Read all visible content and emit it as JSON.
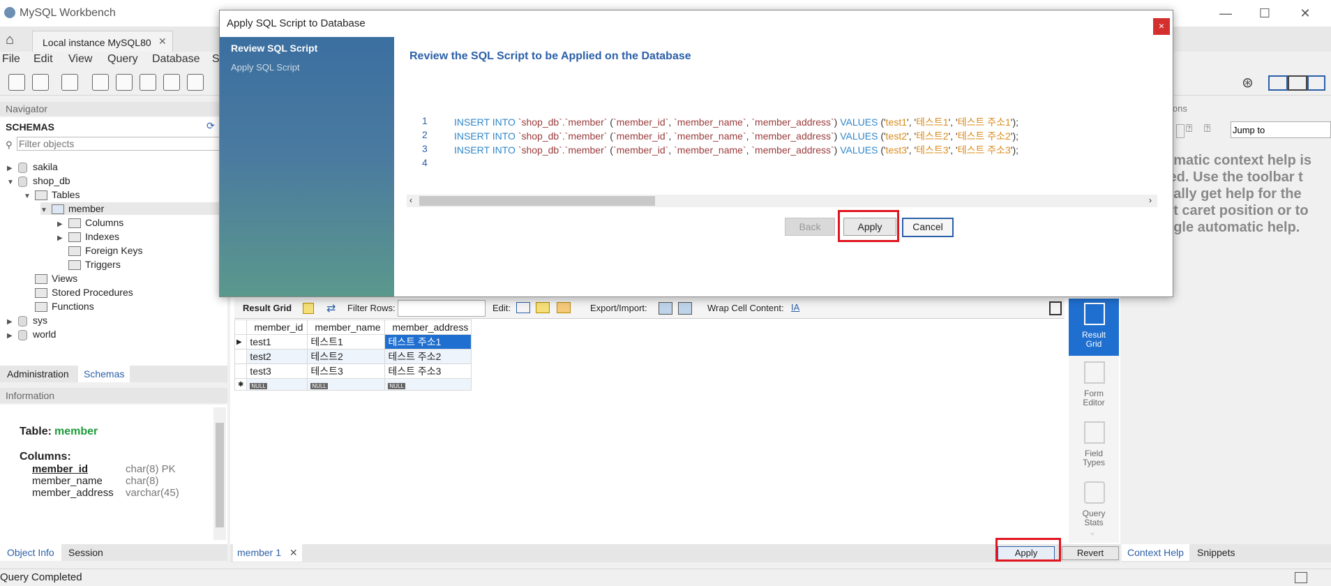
{
  "window": {
    "app_title": "MySQL Workbench",
    "connection_tab": "Local instance MySQL80"
  },
  "menu": [
    "File",
    "Edit",
    "View",
    "Query",
    "Database",
    "S"
  ],
  "navigator": {
    "header": "Navigator",
    "schemas_label": "SCHEMAS",
    "filter_placeholder": "Filter objects",
    "tree": [
      {
        "label": "sakila",
        "level": 0,
        "type": "db",
        "expander": "▶"
      },
      {
        "label": "shop_db",
        "level": 0,
        "type": "db",
        "expander": "▼"
      },
      {
        "label": "Tables",
        "level": 1,
        "type": "folder",
        "expander": "▼"
      },
      {
        "label": "member",
        "level": 2,
        "type": "table",
        "expander": "▼"
      },
      {
        "label": "Columns",
        "level": 3,
        "type": "folder",
        "expander": "▶"
      },
      {
        "label": "Indexes",
        "level": 3,
        "type": "folder",
        "expander": "▶"
      },
      {
        "label": "Foreign Keys",
        "level": 3,
        "type": "folder",
        "expander": ""
      },
      {
        "label": "Triggers",
        "level": 3,
        "type": "folder",
        "expander": ""
      },
      {
        "label": "Views",
        "level": 1,
        "type": "folder",
        "expander": ""
      },
      {
        "label": "Stored Procedures",
        "level": 1,
        "type": "folder",
        "expander": ""
      },
      {
        "label": "Functions",
        "level": 1,
        "type": "folder",
        "expander": ""
      },
      {
        "label": "sys",
        "level": 0,
        "type": "db",
        "expander": "▶"
      },
      {
        "label": "world",
        "level": 0,
        "type": "db",
        "expander": "▶"
      }
    ],
    "tabs": [
      "Administration",
      "Schemas"
    ]
  },
  "information": {
    "header": "Information",
    "table_label": "Table:",
    "table_name": "member",
    "columns_label": "Columns:",
    "columns": [
      {
        "name": "member_id",
        "type": "char(8) PK"
      },
      {
        "name": "member_name",
        "type": "char(8)"
      },
      {
        "name": "member_address",
        "type": "varchar(45)"
      }
    ],
    "tabs": [
      "Object Info",
      "Session"
    ]
  },
  "dialog": {
    "title": "Apply SQL Script to Database",
    "close": "×",
    "steps": [
      "Review SQL Script",
      "Apply SQL Script"
    ],
    "heading": "Review the SQL Script to be Applied on the Database",
    "lines": [
      {
        "n": "1",
        "id": "test1",
        "name": "테스트1",
        "addr": "테스트 주소1"
      },
      {
        "n": "2",
        "id": "test2",
        "name": "테스트2",
        "addr": "테스트 주소2"
      },
      {
        "n": "3",
        "id": "test3",
        "name": "테스트3",
        "addr": "테스트 주소3"
      },
      {
        "n": "4"
      }
    ],
    "sql_parts": {
      "insert": "INSERT INTO",
      "table": "`shop_db`.`member`",
      "cols_open": " (",
      "col1": "`member_id`",
      "col2": "`member_name`",
      "col3": "`member_address`",
      "values": "VALUES",
      "comma": ", ",
      "close": ");"
    },
    "buttons": {
      "back": "Back",
      "apply": "Apply",
      "cancel": "Cancel"
    }
  },
  "result": {
    "toolbar": {
      "result_grid": "Result Grid",
      "filter_rows": "Filter Rows:",
      "edit": "Edit:",
      "export_import": "Export/Import:",
      "wrap": "Wrap Cell Content:"
    },
    "columns": [
      "member_id",
      "member_name",
      "member_address"
    ],
    "rows": [
      [
        "test1",
        "테스트1",
        "테스트 주소1"
      ],
      [
        "test2",
        "테스트2",
        "테스트 주소2"
      ],
      [
        "test3",
        "테스트3",
        "테스트 주소3"
      ]
    ],
    "null_label": "NULL",
    "tab": "member 1",
    "apply": "Apply",
    "revert": "Revert"
  },
  "side_tabs": [
    {
      "label": "Result Grid",
      "active": true
    },
    {
      "label": "Form Editor",
      "active": false
    },
    {
      "label": "Field Types",
      "active": false
    },
    {
      "label": "Query Stats",
      "active": false
    }
  ],
  "right_panel": {
    "header_partial": "ions",
    "jump_to": "Jump to",
    "help_lines": [
      "omatic context help is",
      "led. Use the toolbar t",
      "ually get help for the",
      "nt caret position or to",
      "ggle automatic help."
    ],
    "tabs": [
      "Context Help",
      "Snippets"
    ]
  },
  "status": "Query Completed",
  "colors": {
    "accent": "#2b5fa8",
    "highlight_red": "#e0151f",
    "green_name": "#1e9a3a"
  }
}
